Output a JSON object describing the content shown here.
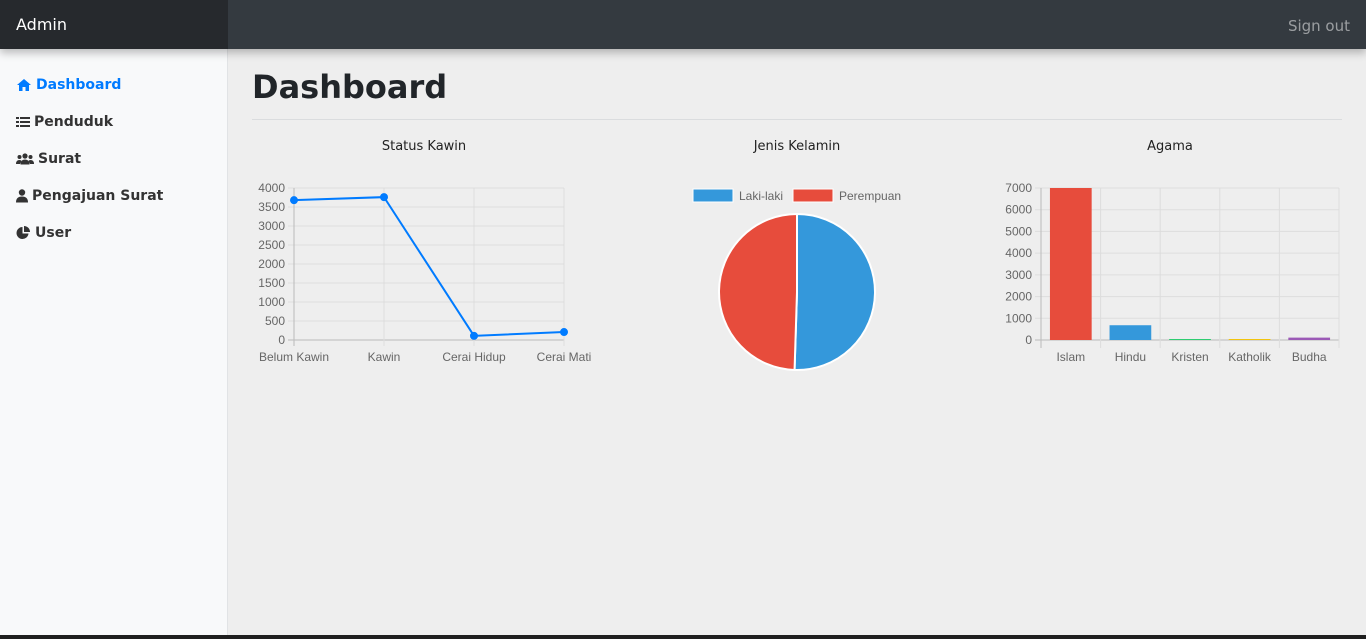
{
  "header": {
    "brand": "Admin",
    "signout_label": "Sign out"
  },
  "sidebar": {
    "items": [
      {
        "label": "Dashboard",
        "icon": "home-icon",
        "active": true
      },
      {
        "label": "Penduduk",
        "icon": "list-icon",
        "active": false
      },
      {
        "label": "Surat",
        "icon": "users-icon",
        "active": false
      },
      {
        "label": "Pengajuan Surat",
        "icon": "user-icon",
        "active": false
      },
      {
        "label": "User",
        "icon": "pie-chart-icon",
        "active": false
      }
    ]
  },
  "main": {
    "title": "Dashboard"
  },
  "colors": {
    "accent": "#007bff",
    "red": "#e74c3c",
    "blue": "#3498db",
    "purple": "#9b59b6",
    "green": "#2ecc71"
  },
  "chart_data": [
    {
      "type": "line",
      "title": "Status Kawin",
      "categories": [
        "Belum Kawin",
        "Kawin",
        "Cerai Hidup",
        "Cerai Mati"
      ],
      "series": [
        {
          "values": [
            3680,
            3760,
            110,
            210
          ],
          "color": "#007bff"
        }
      ],
      "ylim": [
        0,
        4000
      ],
      "yticks": [
        0,
        500,
        1000,
        1500,
        2000,
        2500,
        3000,
        3500,
        4000
      ],
      "grid": true
    },
    {
      "type": "pie",
      "title": "Jenis Kelamin",
      "legend_position": "top",
      "labels": [
        "Laki-laki",
        "Perempuan"
      ],
      "values": [
        50.5,
        49.5
      ],
      "colors": [
        "#3498db",
        "#e74c3c"
      ]
    },
    {
      "type": "bar",
      "title": "Agama",
      "categories": [
        "Islam",
        "Hindu",
        "Kristen",
        "Katholik",
        "Budha"
      ],
      "values": [
        7000,
        680,
        10,
        5,
        110
      ],
      "colors": [
        "#e74c3c",
        "#3498db",
        "#2ecc71",
        "#f1c40f",
        "#9b59b6"
      ],
      "ylim": [
        0,
        7000
      ],
      "yticks": [
        0,
        1000,
        2000,
        3000,
        4000,
        5000,
        6000,
        7000
      ],
      "grid": true
    }
  ]
}
